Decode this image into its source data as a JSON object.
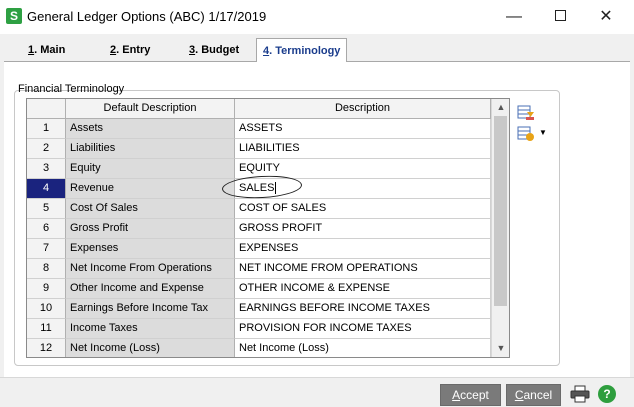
{
  "window": {
    "title": "General Ledger Options (ABC) 1/17/2019",
    "app_icon_letter": "S",
    "minimize_glyph": "—",
    "close_glyph": "✕"
  },
  "tabs": [
    {
      "mnemonic": "1",
      "label": ". Main",
      "active": false
    },
    {
      "mnemonic": "2",
      "label": ". Entry",
      "active": false
    },
    {
      "mnemonic": "3",
      "label": ". Budget",
      "active": false
    },
    {
      "mnemonic": "4",
      "label": ". Terminology",
      "active": true
    }
  ],
  "group_label": "Financial Terminology",
  "grid": {
    "columns": [
      "",
      "Default Description",
      "Description"
    ],
    "rows": [
      {
        "num": "1",
        "default": "Assets",
        "desc": "ASSETS"
      },
      {
        "num": "2",
        "default": "Liabilities",
        "desc": "LIABILITIES"
      },
      {
        "num": "3",
        "default": "Equity",
        "desc": "EQUITY"
      },
      {
        "num": "4",
        "default": "Revenue",
        "desc": "SALES",
        "selected": true
      },
      {
        "num": "5",
        "default": "Cost Of Sales",
        "desc": "COST OF SALES"
      },
      {
        "num": "6",
        "default": "Gross Profit",
        "desc": "GROSS PROFIT"
      },
      {
        "num": "7",
        "default": "Expenses",
        "desc": "EXPENSES"
      },
      {
        "num": "8",
        "default": "Net Income From Operations",
        "desc": "NET INCOME FROM OPERATIONS"
      },
      {
        "num": "9",
        "default": "Other Income and Expense",
        "desc": "OTHER INCOME & EXPENSE"
      },
      {
        "num": "10",
        "default": "Earnings Before Income Tax",
        "desc": "EARNINGS BEFORE INCOME TAXES"
      },
      {
        "num": "11",
        "default": "Income Taxes",
        "desc": "PROVISION FOR INCOME TAXES"
      },
      {
        "num": "12",
        "default": "Net Income (Loss)",
        "desc": "Net Income (Loss)"
      }
    ]
  },
  "buttons": {
    "accept_mnemonic": "A",
    "accept_rest": "ccept",
    "cancel_mnemonic": "C",
    "cancel_rest": "ancel",
    "help_glyph": "?"
  },
  "colors": {
    "selected_row": "#1a237e",
    "active_tab_text": "#1a3c8c",
    "button_bg": "#7a7a7a",
    "help_green": "#2e9e3e"
  },
  "icons": [
    "app-icon",
    "minimize-icon",
    "maximize-icon",
    "close-icon",
    "scroll-up-icon",
    "scroll-down-icon",
    "grid-settings-icon",
    "grid-options-icon",
    "printer-icon",
    "help-icon"
  ]
}
